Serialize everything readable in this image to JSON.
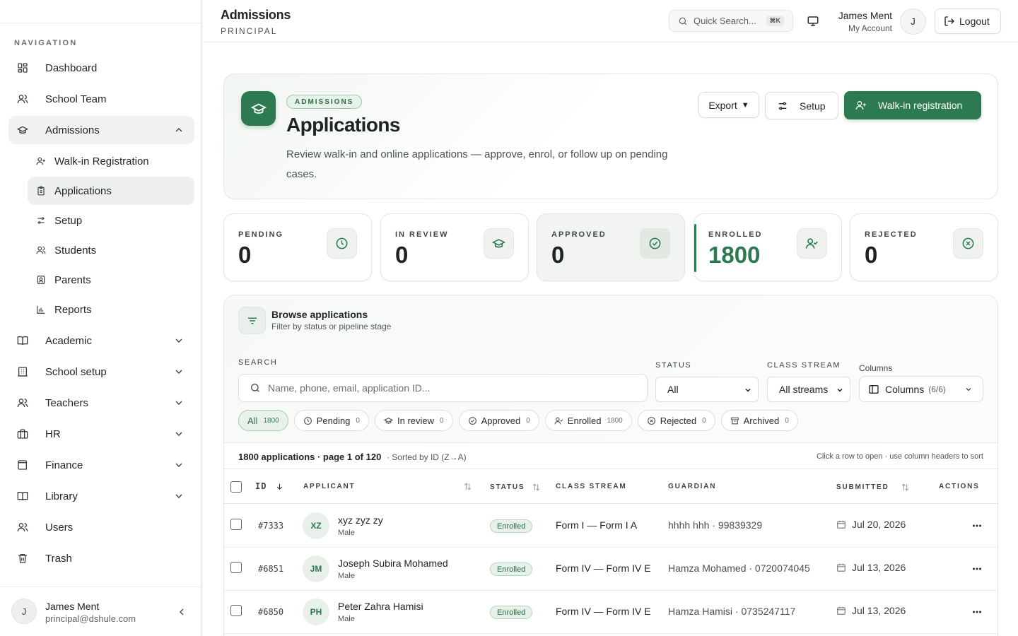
{
  "sidebar": {
    "heading": "NAVIGATION",
    "items": {
      "dashboard": "Dashboard",
      "school_team": "School Team",
      "admissions": "Admissions",
      "academic": "Academic",
      "school_setup": "School setup",
      "teachers": "Teachers",
      "hr": "HR",
      "finance": "Finance",
      "library": "Library",
      "users": "Users",
      "trash": "Trash"
    },
    "sub_items": {
      "walkin": "Walk-in Registration",
      "applications": "Applications",
      "setup": "Setup",
      "students": "Students",
      "parents": "Parents",
      "reports": "Reports"
    },
    "user": {
      "initial": "J",
      "name": "James Ment",
      "email": "principal@dshule.com"
    }
  },
  "header": {
    "title": "Admissions",
    "role": "PRINCIPAL",
    "search_placeholder": "Quick Search...",
    "search_shortcut": "⌘K",
    "user_name": "James Ment",
    "user_sub": "My Account",
    "avatar_initial": "J",
    "logout": "Logout"
  },
  "hero": {
    "badge": "ADMISSIONS",
    "title": "Applications",
    "description": "Review walk-in and online applications — approve, enrol, or follow up on pending cases.",
    "export": "Export",
    "setup": "Setup",
    "walkin": "Walk-in registration"
  },
  "stats": {
    "pending": {
      "label": "PENDING",
      "value": "0"
    },
    "in_review": {
      "label": "IN REVIEW",
      "value": "0"
    },
    "approved": {
      "label": "APPROVED",
      "value": "0"
    },
    "enrolled": {
      "label": "ENROLLED",
      "value": "1800"
    },
    "rejected": {
      "label": "REJECTED",
      "value": "0"
    }
  },
  "browse": {
    "title": "Browse applications",
    "subtitle": "Filter by status or pipeline stage",
    "search_label": "SEARCH",
    "search_placeholder": "Name, phone, email, application ID...",
    "status_label": "STATUS",
    "status_value": "All",
    "stream_label": "CLASS STREAM",
    "stream_value": "All streams",
    "columns_label": "Columns",
    "columns_button": "Columns",
    "columns_count": "(6/6)",
    "chips": {
      "all": {
        "label": "All",
        "count": "1800"
      },
      "pending": {
        "label": "Pending",
        "count": "0"
      },
      "in_review": {
        "label": "In review",
        "count": "0"
      },
      "approved": {
        "label": "Approved",
        "count": "0"
      },
      "enrolled": {
        "label": "Enrolled",
        "count": "1800"
      },
      "rejected": {
        "label": "Rejected",
        "count": "0"
      },
      "archived": {
        "label": "Archived",
        "count": "0"
      }
    },
    "summary": "1800 applications · page 1 of 120",
    "sorted": "· Sorted by ID (Z→A)",
    "hint": "Click a row to open · use column headers to sort"
  },
  "table": {
    "headers": {
      "id": "ID",
      "applicant": "APPLICANT",
      "status": "STATUS",
      "class_stream": "CLASS STREAM",
      "guardian": "GUARDIAN",
      "submitted": "SUBMITTED",
      "actions": "ACTIONS"
    },
    "rows": [
      {
        "id": "#7333",
        "initials": "XZ",
        "name": "xyz zyz zy",
        "gender": "Male",
        "status": "Enrolled",
        "stream": "Form I — Form I A",
        "guardian": "hhhh hhh · 99839329",
        "submitted": "Jul 20, 2026"
      },
      {
        "id": "#6851",
        "initials": "JM",
        "name": "Joseph Subira Mohamed",
        "gender": "Male",
        "status": "Enrolled",
        "stream": "Form IV — Form IV E",
        "guardian": "Hamza Mohamed · 0720074045",
        "submitted": "Jul 13, 2026"
      },
      {
        "id": "#6850",
        "initials": "PH",
        "name": "Peter Zahra Hamisi",
        "gender": "Male",
        "status": "Enrolled",
        "stream": "Form IV — Form IV E",
        "guardian": "Hamza Hamisi · 0735247117",
        "submitted": "Jul 13, 2026"
      }
    ]
  },
  "colors": {
    "brand": "#2d7a50",
    "brand_light": "#e7f2ea"
  }
}
